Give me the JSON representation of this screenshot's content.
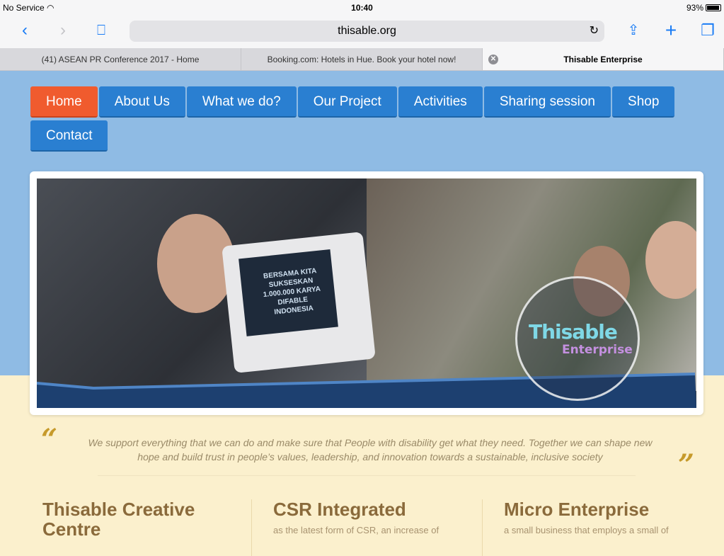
{
  "status": {
    "carrier": "No Service",
    "time": "10:40",
    "battery": "93%"
  },
  "toolbar": {
    "url": "thisable.org"
  },
  "tabs": [
    {
      "label": "(41) ASEAN PR Conference 2017 - Home",
      "active": false
    },
    {
      "label": "Booking.com: Hotels in Hue. Book your hotel now!",
      "active": false
    },
    {
      "label": "Thisable Enterprise",
      "active": true
    }
  ],
  "nav": [
    "Home",
    "About Us",
    "What we do?",
    "Our Project",
    "Activities",
    "Sharing session",
    "Shop",
    "Contact"
  ],
  "hero": {
    "laptop_text": "BERSAMA KITA SUKSESKAN 1.000.000 KARYA DIFABLE INDONESIA",
    "logo_top": "Thisable",
    "logo_bottom": "Enterprise"
  },
  "quote": {
    "open": "“",
    "close": "”",
    "text": "We support everything that we can do and make sure that People with disability get what they need. Together we can shape new hope and build trust in people’s values, leadership, and innovation towards a sustainable, inclusive society"
  },
  "features": [
    {
      "title": "Thisable Creative Centre",
      "text": ""
    },
    {
      "title": "CSR Integrated",
      "text": "as the latest form of CSR, an increase of"
    },
    {
      "title": "Micro Enterprise",
      "text": "a small business that employs a small of"
    }
  ]
}
